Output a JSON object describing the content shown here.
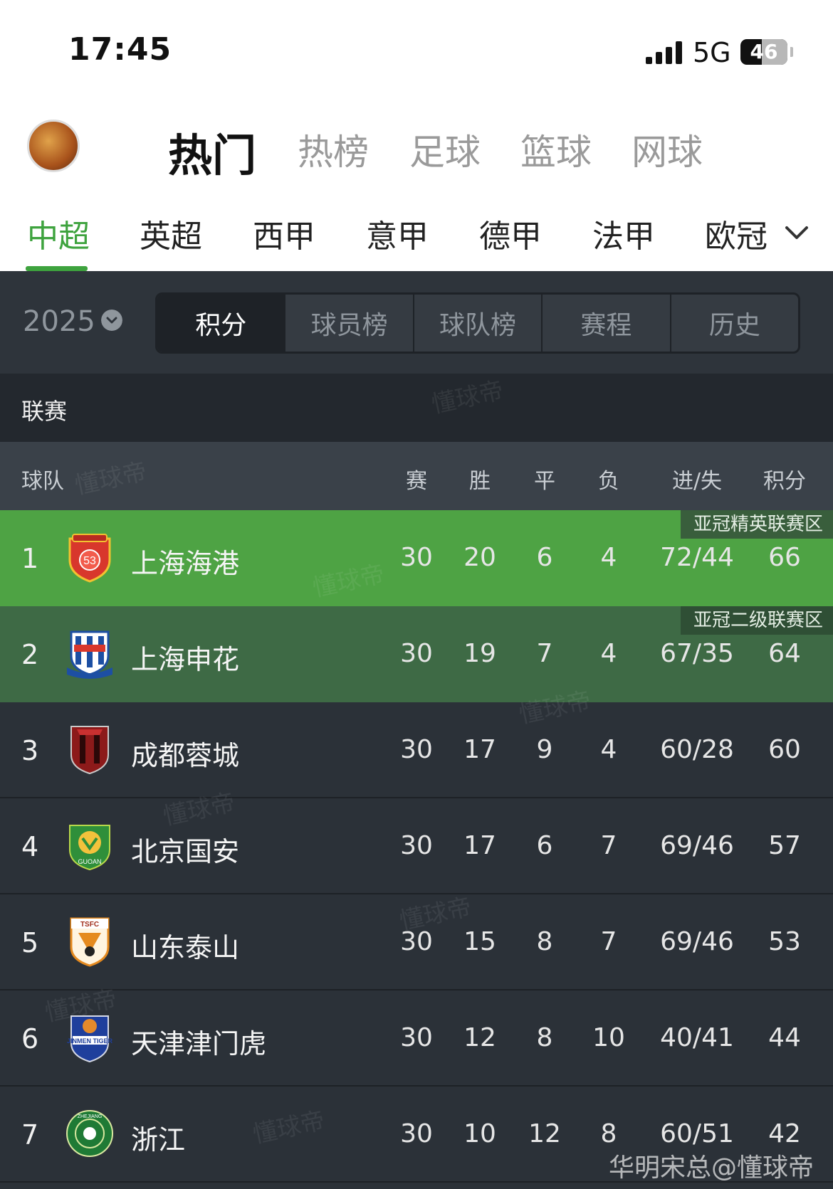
{
  "status": {
    "time": "17:45",
    "network": "5G",
    "battery": "46",
    "battery_level": 0.46
  },
  "top_nav": {
    "tabs": [
      "热门",
      "热榜",
      "足球",
      "篮球",
      "网球"
    ],
    "active": 0
  },
  "league_nav": {
    "tabs": [
      "中超",
      "英超",
      "西甲",
      "意甲",
      "德甲",
      "法甲",
      "欧冠"
    ],
    "active": 0
  },
  "sub_nav": {
    "season": "2025",
    "tabs": [
      "积分",
      "球员榜",
      "球队榜",
      "赛程",
      "历史"
    ],
    "active": 0
  },
  "section_title": "联赛",
  "columns": {
    "team": "球队",
    "played": "赛",
    "won": "胜",
    "drawn": "平",
    "lost": "负",
    "goals": "进/失",
    "points": "积分"
  },
  "rows": [
    {
      "rank": "1",
      "team": "上海海港",
      "played": "30",
      "won": "20",
      "drawn": "6",
      "lost": "4",
      "goals": "72/44",
      "points": "66",
      "zone": "亚冠精英联赛区",
      "logo": "shanghai-port-logo"
    },
    {
      "rank": "2",
      "team": "上海申花",
      "played": "30",
      "won": "19",
      "drawn": "7",
      "lost": "4",
      "goals": "67/35",
      "points": "64",
      "zone": "亚冠二级联赛区",
      "logo": "shanghai-shenhua-logo"
    },
    {
      "rank": "3",
      "team": "成都蓉城",
      "played": "30",
      "won": "17",
      "drawn": "9",
      "lost": "4",
      "goals": "60/28",
      "points": "60",
      "zone": "",
      "logo": "chengdu-rongcheng-logo"
    },
    {
      "rank": "4",
      "team": "北京国安",
      "played": "30",
      "won": "17",
      "drawn": "6",
      "lost": "7",
      "goals": "69/46",
      "points": "57",
      "zone": "",
      "logo": "beijing-guoan-logo"
    },
    {
      "rank": "5",
      "team": "山东泰山",
      "played": "30",
      "won": "15",
      "drawn": "8",
      "lost": "7",
      "goals": "69/46",
      "points": "53",
      "zone": "",
      "logo": "shandong-taishan-logo"
    },
    {
      "rank": "6",
      "team": "天津津门虎",
      "played": "30",
      "won": "12",
      "drawn": "8",
      "lost": "10",
      "goals": "40/41",
      "points": "44",
      "zone": "",
      "logo": "tianjin-jinmen-tiger-logo"
    },
    {
      "rank": "7",
      "team": "浙江",
      "played": "30",
      "won": "10",
      "drawn": "12",
      "lost": "8",
      "goals": "60/51",
      "points": "42",
      "zone": "",
      "logo": "zhejiang-logo"
    }
  ],
  "watermark": "懂球帝",
  "credit": "华明宋总@懂球帝",
  "colors": {
    "accent": "#3ea33e",
    "zone1": "#4ea344",
    "zone2": "#3e6a45",
    "bg": "#2b3138"
  }
}
